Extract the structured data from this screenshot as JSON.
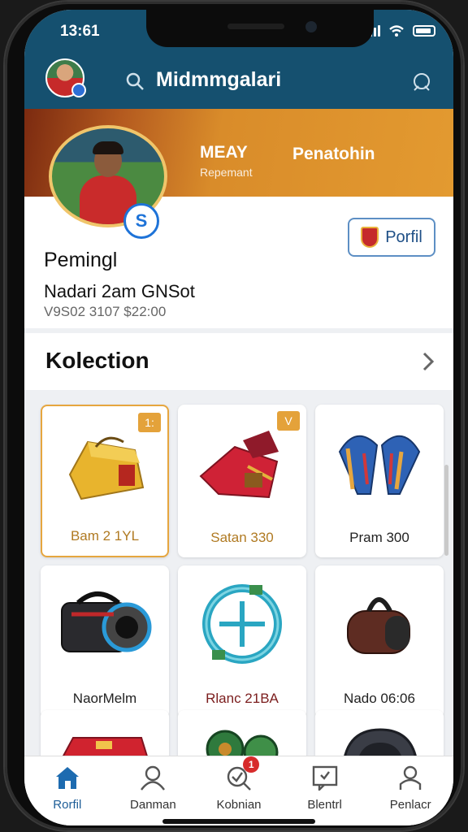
{
  "status": {
    "time": "13:61"
  },
  "header": {
    "title": "Midmmgalari"
  },
  "banner": {
    "stat1_value": "MEAY",
    "stat1_label": "Repemant",
    "stat2_value": "Penatohin"
  },
  "profile": {
    "badge_letter": "S",
    "name": "Pemingl",
    "team": "Nadari 2am GNSot",
    "meta": "V9S02 3107 $22:00",
    "button_label": "Porfil"
  },
  "collection": {
    "title": "Kolection",
    "items": [
      {
        "label": "Bam 2 1YL",
        "corner": "1:"
      },
      {
        "label": "Satan 330",
        "corner": "V"
      },
      {
        "label": "Pram 300"
      },
      {
        "label": "NaorMelm"
      },
      {
        "label": "Rlanc 21BA"
      },
      {
        "label": "Nado 06:06"
      }
    ]
  },
  "nav": {
    "items": [
      {
        "label": "Rorfil"
      },
      {
        "label": "Danman"
      },
      {
        "label": "Kobnian",
        "badge": "1"
      },
      {
        "label": "Blentrl"
      },
      {
        "label": "Penlacr"
      }
    ]
  },
  "colors": {
    "header": "#15506f",
    "banner": "#e39a30",
    "accent": "#1e73d8"
  }
}
